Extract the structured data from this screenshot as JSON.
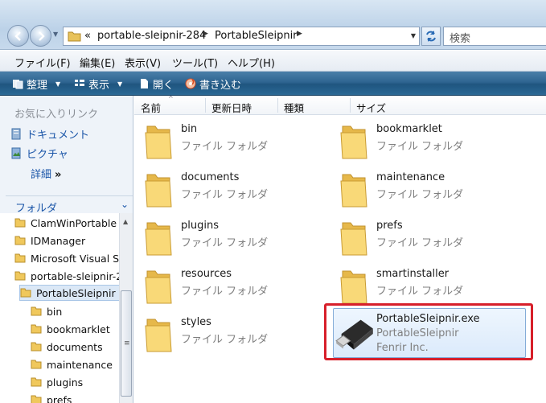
{
  "address": {
    "overflow": "«",
    "crumbs": [
      "portable-sleipnir-284",
      "PortableSleipnir"
    ],
    "search_placeholder": "検索"
  },
  "menu": [
    "ファイル(F)",
    "編集(E)",
    "表示(V)",
    "ツール(T)",
    "ヘルプ(H)"
  ],
  "commands": {
    "organize": "整理",
    "view": "表示",
    "open": "開く",
    "burn": "書き込む"
  },
  "left": {
    "favorites_title": "お気に入りリンク",
    "favorites": [
      "ドキュメント",
      "ピクチャ"
    ],
    "more": "詳細",
    "more_chevron": "»",
    "folders_title": "フォルダ",
    "tree": [
      {
        "label": "ClamWinPortable",
        "level": 0
      },
      {
        "label": "IDManager",
        "level": 0
      },
      {
        "label": "Microsoft Visual St",
        "level": 0
      },
      {
        "label": "portable-sleipnir-2",
        "level": 0
      },
      {
        "label": "PortableSleipnir",
        "level": 1,
        "selected": true
      },
      {
        "label": "bin",
        "level": 2
      },
      {
        "label": "bookmarklet",
        "level": 2
      },
      {
        "label": "documents",
        "level": 2
      },
      {
        "label": "maintenance",
        "level": 2
      },
      {
        "label": "plugins",
        "level": 2
      },
      {
        "label": "prefs",
        "level": 2
      }
    ]
  },
  "columns": [
    "名前",
    "更新日時",
    "種類",
    "サイズ"
  ],
  "folder_type": "ファイル フォルダ",
  "items": [
    {
      "name": "bin"
    },
    {
      "name": "bookmarklet"
    },
    {
      "name": "documents"
    },
    {
      "name": "maintenance"
    },
    {
      "name": "plugins"
    },
    {
      "name": "prefs"
    },
    {
      "name": "resources"
    },
    {
      "name": "smartinstaller"
    },
    {
      "name": "styles"
    }
  ],
  "exe": {
    "name": "PortableSleipnir.exe",
    "description": "PortableSleipnir",
    "company": "Fenrir Inc."
  },
  "colors": {
    "highlight_box": "#d71f2a",
    "link": "#1a55a8",
    "command_bar": "#2f6591"
  }
}
